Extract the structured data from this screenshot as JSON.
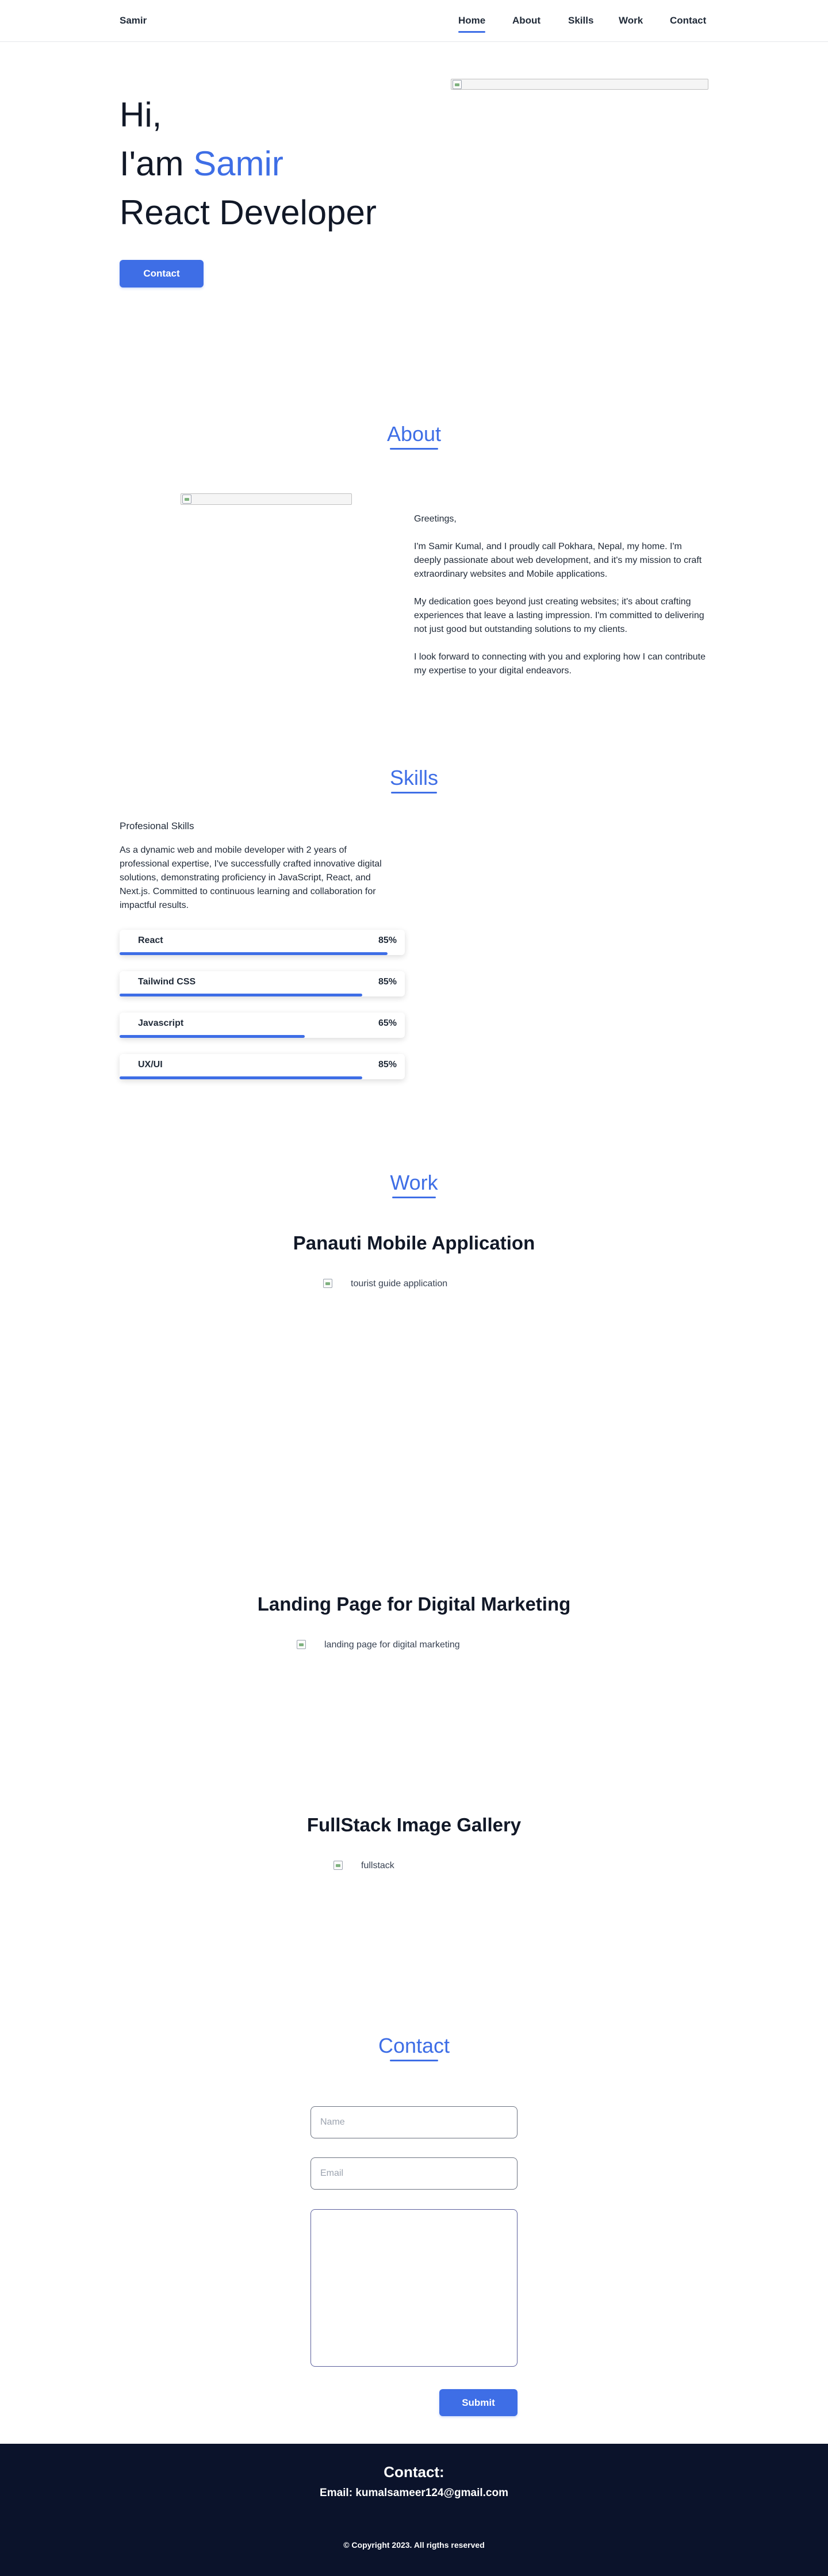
{
  "nav": {
    "brand": "Samir",
    "links": [
      "Home",
      "About",
      "Skills",
      "Work",
      "Contact"
    ],
    "active": "Home",
    "accent": "#3e6ee6"
  },
  "hero": {
    "greeting": "Hi,",
    "intro_prefix": "I'am ",
    "name": "Samir",
    "role": "React Developer",
    "contact_button": "Contact"
  },
  "about": {
    "title": "About",
    "paragraphs": [
      "Greetings,",
      "I'm Samir Kumal, and I proudly call Pokhara, Nepal, my home. I'm deeply passionate about web development, and it's my mission to craft extraordinary websites and Mobile applications.",
      "My dedication goes beyond just creating websites; it's about crafting experiences that leave a lasting impression. I'm committed to delivering not just good but outstanding solutions to my clients.",
      "I look forward to connecting with you and exploring how I can contribute my expertise to your digital endeavors."
    ]
  },
  "skills": {
    "title": "Skills",
    "subtitle": "Profesional Skills",
    "description": "As a dynamic web and mobile developer with 2 years of professional expertise, I've successfully crafted innovative digital solutions, demonstrating proficiency in JavaScript, React, and Next.js. Committed to continuous learning and collaboration for impactful results.",
    "items": [
      {
        "name": "React",
        "percent_label": "85%",
        "level": 0.94
      },
      {
        "name": "Tailwind CSS",
        "percent_label": "85%",
        "level": 0.85
      },
      {
        "name": "Javascript",
        "percent_label": "65%",
        "level": 0.65
      },
      {
        "name": "UX/UI",
        "percent_label": "85%",
        "level": 0.85
      }
    ]
  },
  "work": {
    "title": "Work",
    "projects": [
      {
        "title": "Panauti Mobile Application",
        "image_alt": "tourist guide application"
      },
      {
        "title": "Landing Page for Digital Marketing",
        "image_alt": "landing page for digital marketing"
      },
      {
        "title": "FullStack Image Gallery",
        "image_alt": "fullstack"
      }
    ]
  },
  "contact": {
    "title": "Contact",
    "name_placeholder": "Name",
    "email_placeholder": "Email",
    "message_value": "",
    "submit_label": "Submit"
  },
  "footer": {
    "heading": "Contact:",
    "email_line": "Email: kumalsameer124@gmail.com",
    "copyright": "© Copyright 2023. All rigths reserved",
    "background": "#0b132b"
  }
}
